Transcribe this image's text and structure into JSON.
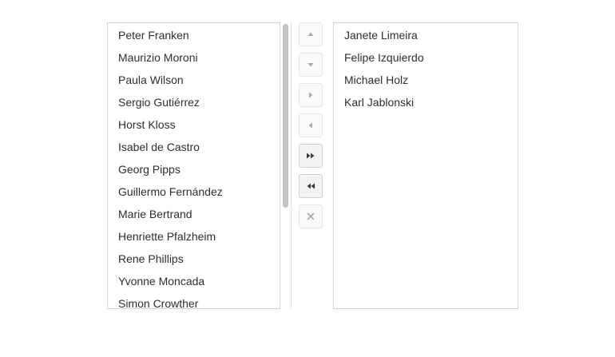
{
  "source_list": {
    "items": [
      "Peter Franken",
      "Maurizio Moroni",
      "Paula Wilson",
      "Sergio Gutiérrez",
      "Horst Kloss",
      "Isabel de Castro",
      "Georg Pipps",
      "Guillermo Fernández",
      "Marie Bertrand",
      "Henriette Pfalzheim",
      "Rene Phillips",
      "Yvonne Moncada",
      "Simon Crowther"
    ]
  },
  "target_list": {
    "items": [
      "Janete Limeira",
      "Felipe Izquierdo",
      "Michael Holz",
      "Karl Jablonski"
    ]
  },
  "toolbar": {
    "buttons": [
      {
        "name": "move-up-button",
        "icon": "triangle-up-icon",
        "enabled": false
      },
      {
        "name": "move-down-button",
        "icon": "triangle-down-icon",
        "enabled": false
      },
      {
        "name": "transfer-to-button",
        "icon": "triangle-right-icon",
        "enabled": false
      },
      {
        "name": "transfer-from-button",
        "icon": "triangle-left-icon",
        "enabled": false
      },
      {
        "name": "transfer-all-to-button",
        "icon": "double-arrow-right-icon",
        "enabled": true
      },
      {
        "name": "transfer-all-from-button",
        "icon": "double-arrow-left-icon",
        "enabled": true
      },
      {
        "name": "remove-button",
        "icon": "close-icon",
        "enabled": false
      }
    ]
  },
  "colors": {
    "text": "#2e2e2e",
    "border": "#d5d5d5",
    "icon_disabled": "#a8a8a8",
    "icon_enabled": "#3a3a3a",
    "scroll_thumb": "#c2c2c2"
  }
}
